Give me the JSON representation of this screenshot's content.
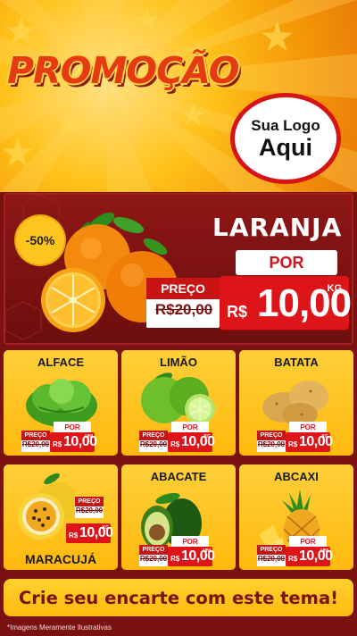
{
  "header": {
    "title": "PROMOÇÃO",
    "logo_line1": "Sua Logo",
    "logo_line2": "Aqui"
  },
  "featured": {
    "discount": "-50%",
    "name": "LARANJA",
    "por": "POR",
    "preco_label": "PREÇO",
    "old_price": "R$20,00",
    "currency": "R$",
    "price": "10,00",
    "unit": "KG"
  },
  "products": [
    {
      "name": "ALFACE",
      "preco_label": "PREÇO",
      "old_price": "R$20,00",
      "por": "POR",
      "currency": "R$",
      "price": "10,00",
      "unit": "UNI"
    },
    {
      "name": "LIMÃO",
      "preco_label": "PREÇO",
      "old_price": "R$20,00",
      "por": "POR",
      "currency": "R$",
      "price": "10,00",
      "unit": "KG"
    },
    {
      "name": "BATATA",
      "preco_label": "PREÇO",
      "old_price": "R$20,00",
      "por": "POR",
      "currency": "R$",
      "price": "10,00",
      "unit": "KG"
    },
    {
      "name": "MARACUJÁ",
      "preco_label": "PREÇO",
      "old_price": "R$20,00",
      "por": "POR",
      "currency": "R$",
      "price": "10,00",
      "unit": "KG"
    },
    {
      "name": "ABACATE",
      "preco_label": "PREÇO",
      "old_price": "R$20,00",
      "por": "POR",
      "currency": "R$",
      "price": "10,00",
      "unit": "UNI"
    },
    {
      "name": "ABCAXI",
      "preco_label": "PREÇO",
      "old_price": "R$20,00",
      "por": "POR",
      "currency": "R$",
      "price": "10,00",
      "unit": "UNI"
    }
  ],
  "footer": {
    "cta": "Crie seu encarte com este tema!",
    "disclaimer": "*Imagens Meramente Ilustrativas"
  },
  "colors": {
    "brand_red": "#dd1418",
    "dark_red": "#7a1212",
    "yellow": "#ffc21a"
  }
}
